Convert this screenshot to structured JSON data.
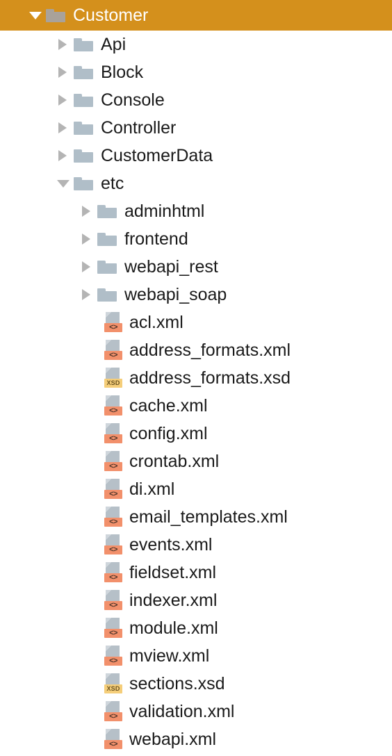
{
  "tree": {
    "root_label": "Customer",
    "nodes": [
      {
        "label": "Customer",
        "kind": "folder",
        "level": 0,
        "state": "expanded",
        "selected": true,
        "icon": "folder-icon"
      },
      {
        "label": "Api",
        "kind": "folder",
        "level": 1,
        "state": "collapsed",
        "selected": false,
        "icon": "folder-icon"
      },
      {
        "label": "Block",
        "kind": "folder",
        "level": 1,
        "state": "collapsed",
        "selected": false,
        "icon": "folder-icon"
      },
      {
        "label": "Console",
        "kind": "folder",
        "level": 1,
        "state": "collapsed",
        "selected": false,
        "icon": "folder-icon"
      },
      {
        "label": "Controller",
        "kind": "folder",
        "level": 1,
        "state": "collapsed",
        "selected": false,
        "icon": "folder-icon"
      },
      {
        "label": "CustomerData",
        "kind": "folder",
        "level": 1,
        "state": "collapsed",
        "selected": false,
        "icon": "folder-icon"
      },
      {
        "label": "etc",
        "kind": "folder",
        "level": 1,
        "state": "expanded",
        "selected": false,
        "icon": "folder-icon"
      },
      {
        "label": "adminhtml",
        "kind": "folder",
        "level": 2,
        "state": "collapsed",
        "selected": false,
        "icon": "folder-icon"
      },
      {
        "label": "frontend",
        "kind": "folder",
        "level": 2,
        "state": "collapsed",
        "selected": false,
        "icon": "folder-icon"
      },
      {
        "label": "webapi_rest",
        "kind": "folder",
        "level": 2,
        "state": "collapsed",
        "selected": false,
        "icon": "folder-icon"
      },
      {
        "label": "webapi_soap",
        "kind": "folder",
        "level": 2,
        "state": "collapsed",
        "selected": false,
        "icon": "folder-icon"
      },
      {
        "label": "acl.xml",
        "kind": "file",
        "level": 2,
        "filetype": "xml",
        "selected": false,
        "icon": "xml-file-icon"
      },
      {
        "label": "address_formats.xml",
        "kind": "file",
        "level": 2,
        "filetype": "xml",
        "selected": false,
        "icon": "xml-file-icon"
      },
      {
        "label": "address_formats.xsd",
        "kind": "file",
        "level": 2,
        "filetype": "xsd",
        "selected": false,
        "icon": "xsd-file-icon"
      },
      {
        "label": "cache.xml",
        "kind": "file",
        "level": 2,
        "filetype": "xml",
        "selected": false,
        "icon": "xml-file-icon"
      },
      {
        "label": "config.xml",
        "kind": "file",
        "level": 2,
        "filetype": "xml",
        "selected": false,
        "icon": "xml-file-icon"
      },
      {
        "label": "crontab.xml",
        "kind": "file",
        "level": 2,
        "filetype": "xml",
        "selected": false,
        "icon": "xml-file-icon"
      },
      {
        "label": "di.xml",
        "kind": "file",
        "level": 2,
        "filetype": "xml",
        "selected": false,
        "icon": "xml-file-icon"
      },
      {
        "label": "email_templates.xml",
        "kind": "file",
        "level": 2,
        "filetype": "xml",
        "selected": false,
        "icon": "xml-file-icon"
      },
      {
        "label": "events.xml",
        "kind": "file",
        "level": 2,
        "filetype": "xml",
        "selected": false,
        "icon": "xml-file-icon"
      },
      {
        "label": "fieldset.xml",
        "kind": "file",
        "level": 2,
        "filetype": "xml",
        "selected": false,
        "icon": "xml-file-icon"
      },
      {
        "label": "indexer.xml",
        "kind": "file",
        "level": 2,
        "filetype": "xml",
        "selected": false,
        "icon": "xml-file-icon"
      },
      {
        "label": "module.xml",
        "kind": "file",
        "level": 2,
        "filetype": "xml",
        "selected": false,
        "icon": "xml-file-icon"
      },
      {
        "label": "mview.xml",
        "kind": "file",
        "level": 2,
        "filetype": "xml",
        "selected": false,
        "icon": "xml-file-icon"
      },
      {
        "label": "sections.xsd",
        "kind": "file",
        "level": 2,
        "filetype": "xsd",
        "selected": false,
        "icon": "xsd-file-icon"
      },
      {
        "label": "validation.xml",
        "kind": "file",
        "level": 2,
        "filetype": "xml",
        "selected": false,
        "icon": "xml-file-icon"
      },
      {
        "label": "webapi.xml",
        "kind": "file",
        "level": 2,
        "filetype": "xml",
        "selected": false,
        "icon": "xml-file-icon"
      }
    ]
  },
  "badges": {
    "xml": "<>",
    "xsd": "XSD"
  },
  "colors": {
    "selection_background": "#d4901c",
    "selection_text": "#ffffff",
    "folder": "#b0bec8",
    "folder_selected": "#a9a29a",
    "twisty": "#b4b4b4",
    "file_page": "#b6c0c8",
    "badge_xml": "#f2906b",
    "badge_xsd": "#f5ce7a",
    "label_text": "#1a1a1a",
    "background": "#ffffff"
  }
}
